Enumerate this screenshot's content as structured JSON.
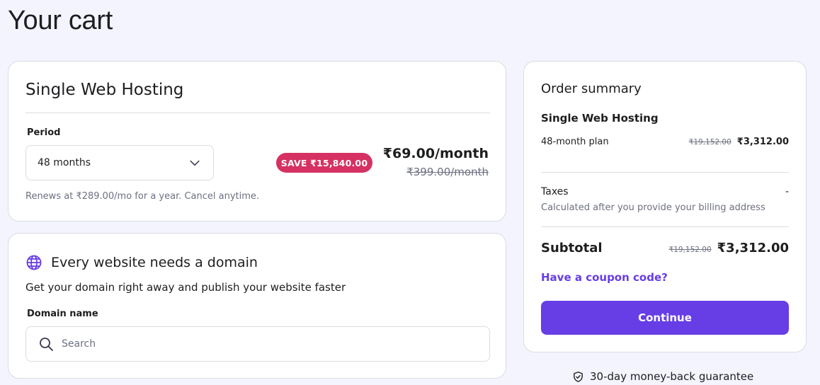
{
  "page": {
    "title": "Your cart"
  },
  "hosting": {
    "title": "Single Web Hosting",
    "period_label": "Period",
    "period_value": "48 months",
    "renew_text": "Renews at ₹289.00/mo for a year. Cancel anytime.",
    "save_badge": "SAVE ₹15,840.00",
    "price": "₹69.00/month",
    "old_price": "₹399.00/month"
  },
  "domain": {
    "title": "Every website needs a domain",
    "description": "Get your domain right away and publish your website faster",
    "label": "Domain name",
    "placeholder": "Search"
  },
  "summary": {
    "title": "Order summary",
    "product": "Single Web Hosting",
    "plan": "48-month plan",
    "plan_old_price": "₹19,152.00",
    "plan_price": "₹3,312.00",
    "taxes_label": "Taxes",
    "taxes_value": "-",
    "taxes_note": "Calculated after you provide your billing address",
    "subtotal_label": "Subtotal",
    "subtotal_old_price": "₹19,152.00",
    "subtotal_price": "₹3,312.00",
    "coupon": "Have a coupon code?",
    "continue": "Continue"
  },
  "guarantee": "30-day money-back guarantee",
  "icons": {
    "period_dropdown": "chevron-down-icon",
    "domain": "globe-icon",
    "search": "search-icon",
    "guarantee": "shield-check-icon"
  },
  "colors": {
    "accent": "#673de6",
    "save_badge": "#d63163",
    "background": "#f4f4ff",
    "text": "#1d1e20",
    "muted": "#6d7081"
  }
}
